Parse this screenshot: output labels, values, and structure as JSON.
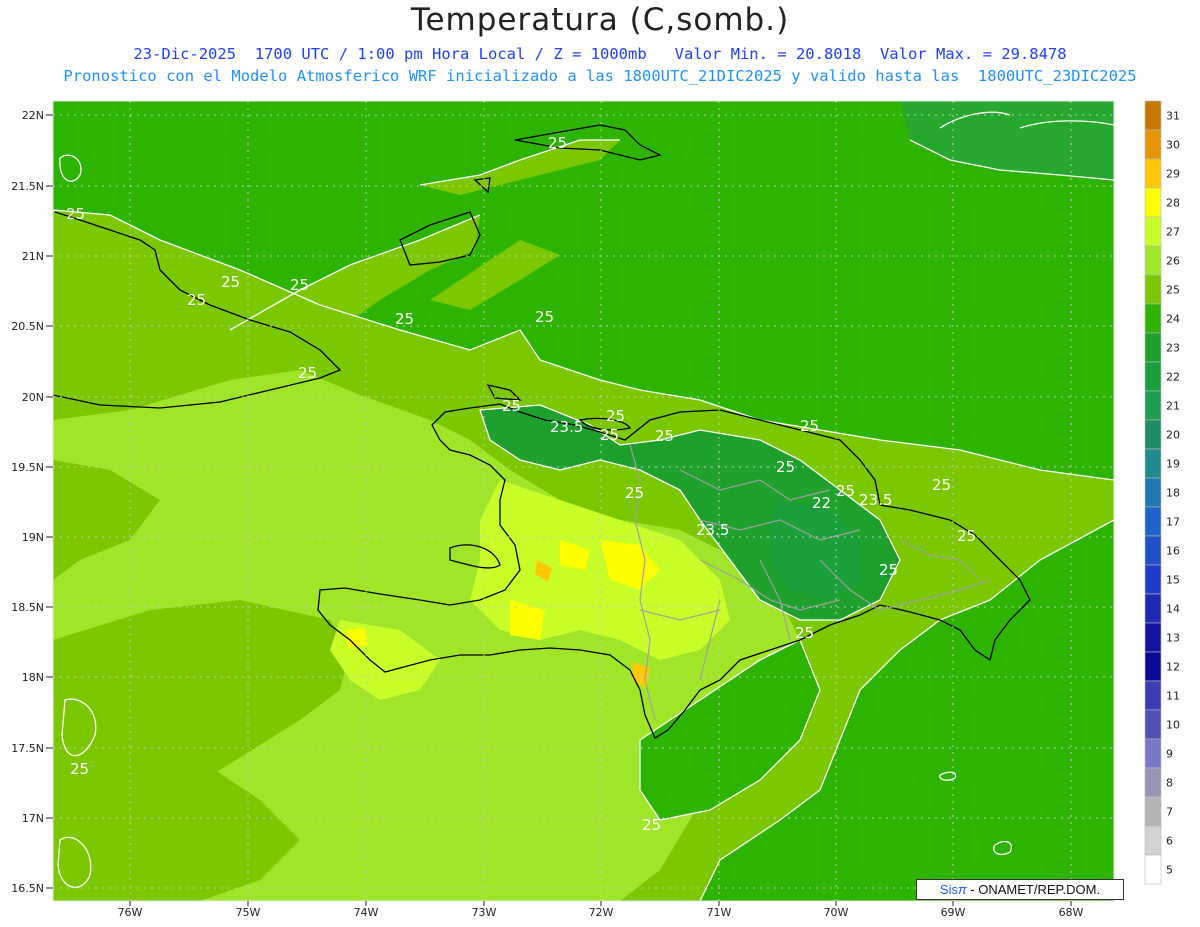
{
  "title": "Temperatura (C,somb.)",
  "subtitle1": "23-Dic-2025  1700 UTC / 1:00 pm Hora Local / Z = 1000mb   Valor Min. = 20.8018  Valor Max. = 29.8478",
  "subtitle2": "Pronostico con el Modelo Atmosferico WRF inicializado a las 1800UTC_21DIC2025 y valido hasta las  1800UTC_23DIC2025",
  "credit": {
    "brand": "Sis",
    "pi": "π",
    "rest": " - ONAMET/REP.DOM."
  },
  "axes": {
    "lat_labels": [
      "22N",
      "21.5N",
      "21N",
      "20.5N",
      "20N",
      "19.5N",
      "19N",
      "18.5N",
      "18N",
      "17.5N",
      "17N",
      "16.5N"
    ],
    "lon_labels": [
      "76W",
      "75W",
      "74W",
      "73W",
      "72W",
      "71W",
      "70W",
      "69W",
      "68W"
    ]
  },
  "colorbar": {
    "levels": [
      "31",
      "30",
      "29",
      "28",
      "27",
      "26",
      "25",
      "24",
      "23",
      "22",
      "21",
      "20",
      "19",
      "18",
      "17",
      "16",
      "15",
      "14",
      "13",
      "12",
      "11",
      "10",
      "9",
      "8",
      "7",
      "6",
      "5"
    ],
    "colors": [
      "#c87800",
      "#e69600",
      "#ffc800",
      "#ffff00",
      "#c8ff28",
      "#a0e628",
      "#7cc800",
      "#2db400",
      "#1ea02d",
      "#19a03c",
      "#1e9e50",
      "#1e8c64",
      "#1e8c8c",
      "#1e78b4",
      "#1e64c8",
      "#1e50c8",
      "#1e3cc8",
      "#1e28b4",
      "#1414a0",
      "#0a0a96",
      "#3c3cb4",
      "#5050b4",
      "#7878c8",
      "#9696b4",
      "#b4b4b4",
      "#d2d2d2",
      "#ffffff"
    ]
  },
  "contour_labels": [
    "25",
    "25",
    "25",
    "25",
    "25",
    "25",
    "25",
    "25",
    "25",
    "23.5",
    "25",
    "25",
    "25",
    "25",
    "25",
    "25",
    "23.5",
    "22",
    "25",
    "23.5",
    "25",
    "25",
    "25",
    "25",
    "25",
    "25"
  ],
  "colors": {
    "title": "#222222",
    "subtitle1": "#1e40ff",
    "subtitle2": "#1e90ff",
    "coast": "#000000",
    "border": "#999999",
    "contour": "#ffffff"
  }
}
